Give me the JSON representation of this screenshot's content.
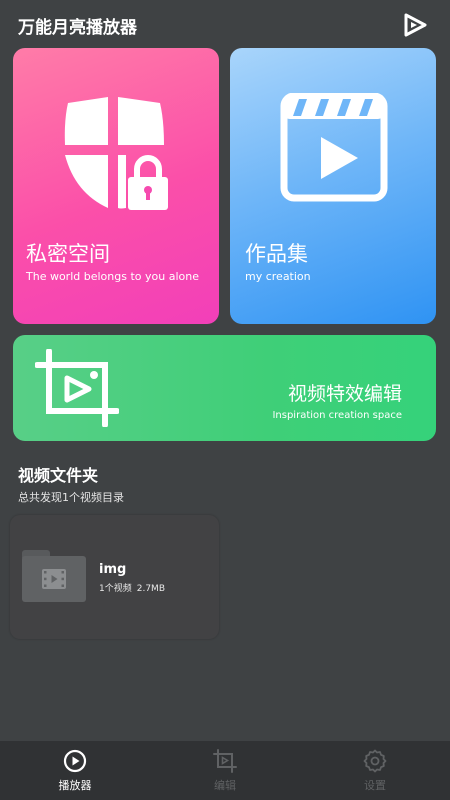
{
  "header": {
    "title": "万能月亮播放器",
    "logo_icon": "play-logo-icon"
  },
  "cards": {
    "private": {
      "title": "私密空间",
      "subtitle": "The world belongs to you alone",
      "icon": "shield-lock-icon",
      "colors": [
        "#ff7ca8",
        "#f23fb9"
      ]
    },
    "works": {
      "title": "作品集",
      "subtitle": "my creation",
      "icon": "clapperboard-icon",
      "colors": [
        "#a9d5fb",
        "#2f93f3"
      ]
    },
    "edit": {
      "title": "视频特效编辑",
      "subtitle": "Inspiration creation space",
      "icon": "crop-play-icon",
      "colors": [
        "#58cf87",
        "#35d27a"
      ]
    }
  },
  "folders": {
    "title": "视频文件夹",
    "summary": "总共发现1个视频目录",
    "items": [
      {
        "name": "img",
        "count": "1个视频",
        "size": "2.7MB",
        "icon": "video-folder-icon"
      }
    ]
  },
  "bottom_nav": {
    "items": [
      {
        "label": "播放器",
        "icon": "play-circle-icon",
        "active": true
      },
      {
        "label": "编辑",
        "icon": "crop-play-icon",
        "active": false
      },
      {
        "label": "设置",
        "icon": "gear-icon",
        "active": false
      }
    ],
    "active_color": "#ffffff",
    "inactive_color": "#606264"
  }
}
